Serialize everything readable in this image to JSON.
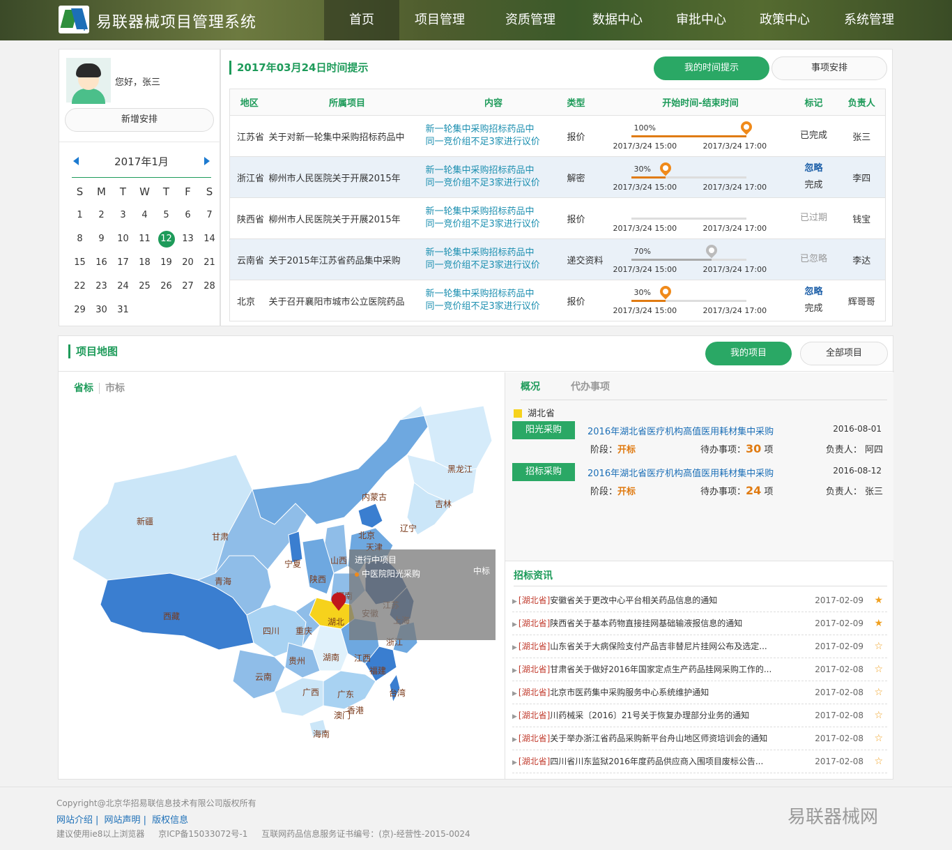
{
  "header": {
    "brand": "易联器械项目管理系统",
    "nav": [
      "首页",
      "项目管理",
      "资质管理",
      "数据中心",
      "审批中心",
      "政策中心",
      "系统管理"
    ]
  },
  "user": {
    "greeting": "您好，张三",
    "add_button": "新增安排"
  },
  "calendar": {
    "title": "2017年1月",
    "weekdays": [
      "S",
      "M",
      "T",
      "W",
      "T",
      "F",
      "S"
    ],
    "days": [
      "1",
      "2",
      "3",
      "4",
      "5",
      "6",
      "7",
      "8",
      "9",
      "10",
      "11",
      "12",
      "13",
      "14",
      "15",
      "16",
      "17",
      "18",
      "19",
      "20",
      "21",
      "22",
      "23",
      "24",
      "25",
      "26",
      "27",
      "28",
      "29",
      "30",
      "31"
    ],
    "selected": "12"
  },
  "tasks": {
    "title": "2017年03月24日时间提示",
    "btn_mine": "我的时间提示",
    "btn_schedule": "事项安排",
    "headers": [
      "地区",
      "所属项目",
      "内容",
      "类型",
      "开始时间-结束时间",
      "标记",
      "负责人"
    ],
    "rows": [
      {
        "region": "江苏省",
        "project": "关于对新一轮集中采购招标药品中",
        "content1": "新一轮集中采购招标药品中",
        "content2": "同一竞价组不足3家进行议价",
        "type": "报价",
        "pct": "100%",
        "progress": 100,
        "start": "2017/3/24 15:00",
        "end": "2017/3/24 17:00",
        "mark1": "已完成",
        "mark2": "",
        "owner": "张三"
      },
      {
        "region": "浙江省",
        "project": "柳州市人民医院关于开展2015年",
        "content1": "新一轮集中采购招标药品中",
        "content2": "同一竞价组不足3家进行议价",
        "type": "解密",
        "pct": "30%",
        "progress": 30,
        "start": "2017/3/24 15:00",
        "end": "2017/3/24 17:00",
        "mark1": "忽略",
        "mark2": "完成",
        "owner": "李四"
      },
      {
        "region": "陕西省",
        "project": "柳州市人民医院关于开展2015年",
        "content1": "新一轮集中采购招标药品中",
        "content2": "同一竞价组不足3家进行议价",
        "type": "报价",
        "pct": "",
        "progress": 0,
        "start": "2017/3/24 15:00",
        "end": "2017/3/24 17:00",
        "mark1": "已过期",
        "mark2": "",
        "owner": "钱宝"
      },
      {
        "region": "云南省",
        "project": "关于2015年江苏省药品集中采购",
        "content1": "新一轮集中采购招标药品中",
        "content2": "同一竞价组不足3家进行议价",
        "type": "递交资料",
        "pct": "70%",
        "progress": 70,
        "start": "2017/3/24 15:00",
        "end": "2017/3/24 17:00",
        "mark1": "已忽略",
        "mark2": "",
        "owner": "李达"
      },
      {
        "region": "北京",
        "project": "关于召开襄阳市城市公立医院药品",
        "content1": "新一轮集中采购招标药品中",
        "content2": "同一竞价组不足3家进行议价",
        "type": "报价",
        "pct": "30%",
        "progress": 30,
        "start": "2017/3/24 15:00",
        "end": "2017/3/24 17:00",
        "mark1": "忽略",
        "mark2": "完成",
        "owner": "辉哥哥"
      }
    ]
  },
  "map": {
    "title": "项目地图",
    "btn_mine": "我的项目",
    "btn_all": "全部项目",
    "tab_province": "省标",
    "tab_city": "市标",
    "provinces": [
      "黑龙江",
      "吉林",
      "辽宁",
      "内蒙古",
      "新疆",
      "甘肃",
      "北京",
      "天津",
      "宁夏",
      "山西",
      "青海",
      "陕西",
      "河南",
      "江苏",
      "西藏",
      "安徽",
      "上海",
      "湖北",
      "四川",
      "重庆",
      "浙江",
      "湖南",
      "江西",
      "贵州",
      "福建",
      "云南",
      "广西",
      "广东",
      "台湾",
      "香港",
      "澳门",
      "海南"
    ],
    "tooltip": {
      "title": "进行中项目",
      "item": "中医院阳光采购",
      "badge": "中标"
    }
  },
  "overview": {
    "tab1": "概况",
    "tab2": "代办事项",
    "province": "湖北省",
    "projects": [
      {
        "tag": "阳光采购",
        "name": "2016年湖北省医疗机构高值医用耗材集中采购",
        "date": "2016-08-01",
        "stage_label": "阶段：",
        "stage": "开标",
        "todo_label": "待办事项：",
        "todo": "30",
        "todo_unit": "项",
        "owner_label": "负责人：",
        "owner": "阿四"
      },
      {
        "tag": "招标采购",
        "name": "2016年湖北省医疗机构高值医用耗材集中采购",
        "date": "2016-08-12",
        "stage_label": "阶段：",
        "stage": "开标",
        "todo_label": "待办事项：",
        "todo": "24",
        "todo_unit": "项",
        "owner_label": "负责人：",
        "owner": "张三"
      }
    ]
  },
  "news": {
    "title": "招标资讯",
    "items": [
      {
        "prov": "[湖北省]",
        "text": "安徽省关于更改中心平台相关药品信息的通知",
        "date": "2017-02-09",
        "star": "★"
      },
      {
        "prov": "[湖北省]",
        "text": "陕西省关于基本药物直接挂网基础输液报信息的通知",
        "date": "2017-02-09",
        "star": "★"
      },
      {
        "prov": "[湖北省]",
        "text": "山东省关于大病保险支付产品吉非替尼片挂网公布及选定...",
        "date": "2017-02-09",
        "star": "☆"
      },
      {
        "prov": "[湖北省]",
        "text": "甘肃省关于做好2016年国家定点生产药品挂网采购工作的...",
        "date": "2017-02-08",
        "star": "☆"
      },
      {
        "prov": "[湖北省]",
        "text": "北京市医药集中采购服务中心系统维护通知",
        "date": "2017-02-08",
        "star": "☆"
      },
      {
        "prov": "[湖北省]",
        "text": "川药械采〔2016〕21号关于恢复办理部分业务的通知",
        "date": "2017-02-08",
        "star": "☆"
      },
      {
        "prov": "[湖北省]",
        "text": "关于举办浙江省药品采购新平台舟山地区师资培训会的通知",
        "date": "2017-02-08",
        "star": "☆"
      },
      {
        "prov": "[湖北省]",
        "text": "四川省川东监狱2016年度药品供应商入围项目废标公告...",
        "date": "2017-02-08",
        "star": "☆"
      }
    ]
  },
  "footer": {
    "copyright": "Copyright@北京华招易联信息技术有限公司版权所有",
    "links": [
      "网站介绍",
      "|",
      "网站声明",
      "|",
      "版权信息"
    ],
    "browser": "建议使用ie8以上浏览器",
    "icp": "京ICP备15033072号-1",
    "license": "互联网药品信息服务证书编号：(京)-经营性-2015-0024",
    "brand": "易联器械网"
  }
}
